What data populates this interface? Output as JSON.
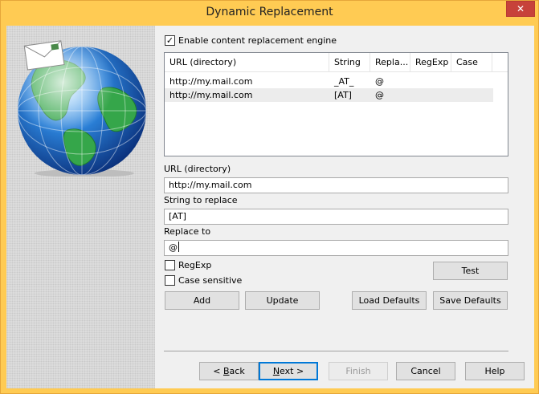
{
  "window": {
    "title": "Dynamic Replacement",
    "close_glyph": "✕"
  },
  "enable_checkbox": {
    "label": "Enable content replacement engine",
    "checked": true
  },
  "table": {
    "columns": [
      "URL (directory)",
      "String",
      "Repla...",
      "RegExp",
      "Case"
    ],
    "rows": [
      {
        "url": "http://my.mail.com",
        "string": "_AT_",
        "replace": "@",
        "regexp": "",
        "case": ""
      },
      {
        "url": "http://my.mail.com",
        "string": "[AT]",
        "replace": "@",
        "regexp": "",
        "case": ""
      }
    ]
  },
  "form": {
    "url_label": "URL (directory)",
    "url_value": "http://my.mail.com",
    "string_label": "String to replace",
    "string_value": "[AT]",
    "replace_label": "Replace to",
    "replace_value": "@",
    "regexp_label": "RegExp",
    "case_label": "Case sensitive"
  },
  "buttons": {
    "test": "Test",
    "add": "Add",
    "update": "Update",
    "load_defaults": "Load Defaults",
    "save_defaults": "Save Defaults"
  },
  "nav": {
    "back_prefix": "< ",
    "back_mnemonic": "B",
    "back_rest": "ack",
    "next_mnemonic": "N",
    "next_rest": "ext >",
    "finish": "Finish",
    "cancel": "Cancel",
    "help": "Help"
  },
  "colors": {
    "frame": "#ffcb53",
    "close": "#c7423a",
    "focus": "#0078d7"
  }
}
